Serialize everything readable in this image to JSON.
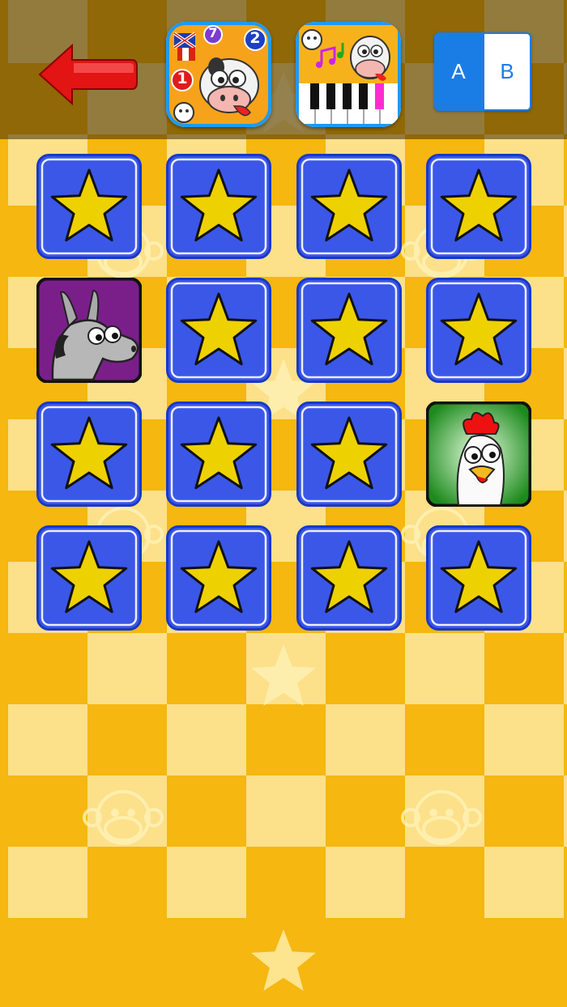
{
  "header": {
    "back_button": {
      "icon": "red-left-arrow-icon"
    },
    "promo_apps": [
      {
        "name": "counting-cow-app-icon",
        "badges": [
          "7",
          "2",
          "1"
        ]
      },
      {
        "name": "piano-cow-app-icon"
      }
    ],
    "ab_toggle": {
      "option_a": "A",
      "option_b": "B",
      "selected": "A"
    }
  },
  "board": {
    "rows": 4,
    "cols": 4,
    "cards": [
      "star",
      "star",
      "star",
      "star",
      "donkey",
      "star",
      "star",
      "star",
      "star",
      "star",
      "star",
      "rooster",
      "star",
      "star",
      "star",
      "star"
    ]
  },
  "colors": {
    "background": "#f5b710",
    "checker_light": "#fce08a",
    "card_blue": "#3b57e8",
    "star_yellow": "#eed100",
    "arrow_red": "#e01010"
  }
}
